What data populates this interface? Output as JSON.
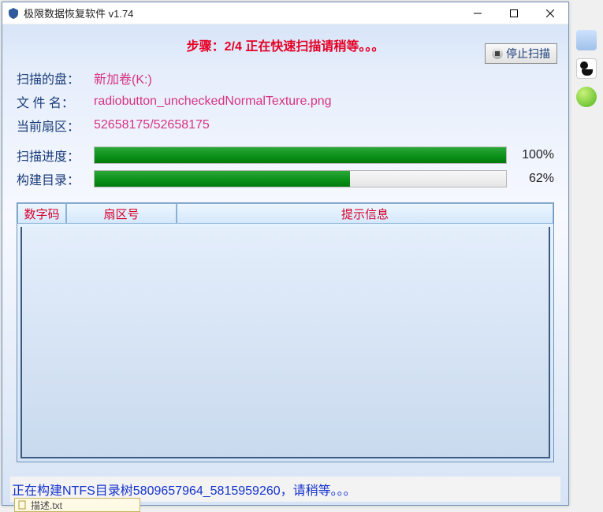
{
  "window": {
    "title": "极限数据恢复软件 v1.74"
  },
  "step": "步骤：2/4 正在快速扫描请稍等。。。",
  "info": {
    "disk_label": "扫描的盘：",
    "disk_value": "新加卷(K:)",
    "file_label": "文 件 名：",
    "file_value": "radiobutton_uncheckedNormalTexture.png",
    "sector_label": "当前扇区：",
    "sector_value": "52658175/52658175"
  },
  "scan": {
    "label": "扫描进度：",
    "percent": 100,
    "percent_text": "100%"
  },
  "build": {
    "label": "构建目录：",
    "percent": 62,
    "percent_text": "62%"
  },
  "stop_button": "停止扫描",
  "table": {
    "h1": "数字码",
    "h2": "扇区号",
    "h3": "提示信息"
  },
  "status": "正在构建NTFS目录树5809657964_5815959260，请稍等。。。",
  "taskbar_item": "描述.txt"
}
